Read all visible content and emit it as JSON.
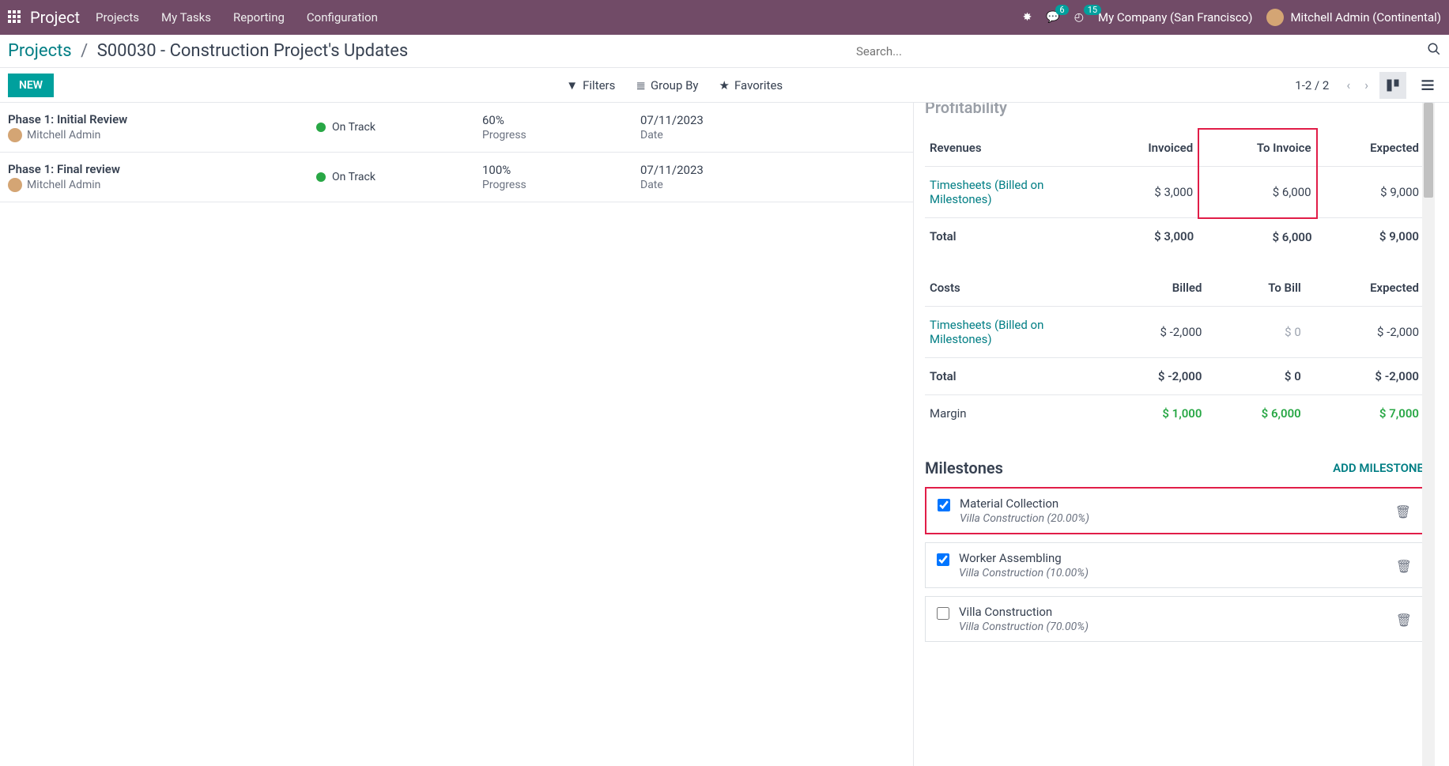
{
  "topnav": {
    "brand": "Project",
    "menu": [
      "Projects",
      "My Tasks",
      "Reporting",
      "Configuration"
    ],
    "chat_badge": "6",
    "clock_badge": "15",
    "company": "My Company (San Francisco)",
    "user": "Mitchell Admin (Continental)"
  },
  "breadcrumb": {
    "root": "Projects",
    "leaf": "S00030 - Construction Project's Updates"
  },
  "search_placeholder": "Search...",
  "toolbar": {
    "new_label": "NEW",
    "filters": "Filters",
    "groupby": "Group By",
    "favorites": "Favorites",
    "pager": "1-2 / 2"
  },
  "list": [
    {
      "title": "Phase 1: Initial Review",
      "author": "Mitchell Admin",
      "status": "On Track",
      "status_color": "#28a745",
      "progress": "60%",
      "progress_label": "Progress",
      "date": "07/11/2023",
      "date_label": "Date"
    },
    {
      "title": "Phase 1: Final review",
      "author": "Mitchell Admin",
      "status": "On Track",
      "status_color": "#28a745",
      "progress": "100%",
      "progress_label": "Progress",
      "date": "07/11/2023",
      "date_label": "Date"
    }
  ],
  "profitability": {
    "section": "Profitability",
    "rev_headers": {
      "rev": "Revenues",
      "invoiced": "Invoiced",
      "toinvoice": "To Invoice",
      "expected": "Expected"
    },
    "rev_rows": [
      {
        "label": "Timesheets (Billed on Milestones)",
        "invoiced": "$ 3,000",
        "toinvoice": "$ 6,000",
        "expected": "$ 9,000",
        "link": true
      }
    ],
    "rev_total": {
      "label": "Total",
      "invoiced": "$ 3,000",
      "toinvoice": "$ 6,000",
      "expected": "$ 9,000"
    },
    "cost_headers": {
      "cost": "Costs",
      "billed": "Billed",
      "tobill": "To Bill",
      "expected": "Expected"
    },
    "cost_rows": [
      {
        "label": "Timesheets (Billed on Milestones)",
        "billed": "$ -2,000",
        "tobill": "$ 0",
        "expected": "$ -2,000",
        "link": true
      }
    ],
    "cost_total": {
      "label": "Total",
      "billed": "$ -2,000",
      "tobill": "$ 0",
      "expected": "$ -2,000"
    },
    "margin": {
      "label": "Margin",
      "c1": "$ 1,000",
      "c2": "$ 6,000",
      "c3": "$ 7,000"
    }
  },
  "milestones": {
    "title": "Milestones",
    "add": "ADD MILESTONE",
    "items": [
      {
        "checked": true,
        "name": "Material Collection",
        "sub": "Villa Construction (20.00%)",
        "highlight": true
      },
      {
        "checked": true,
        "name": "Worker Assembling",
        "sub": "Villa Construction (10.00%)",
        "highlight": false
      },
      {
        "checked": false,
        "name": "Villa Construction",
        "sub": "Villa Construction (70.00%)",
        "highlight": false
      }
    ]
  }
}
